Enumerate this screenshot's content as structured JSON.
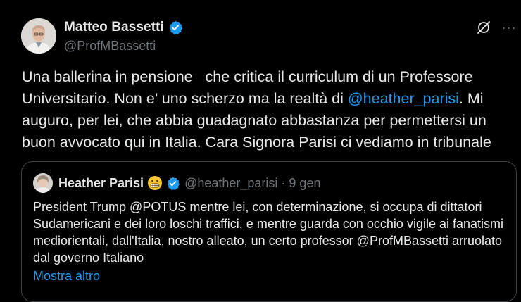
{
  "post": {
    "author": {
      "name": "Matteo Bassetti",
      "handle": "@ProfMBassetti",
      "verified": true
    },
    "text_part1": "Una ballerina in pensione   che critica il curriculum di un Professore Universitario. Non e’ uno scherzo ma la realtà di ",
    "mention": "@heather_parisi",
    "text_part2": ". Mi auguro, per lei, che abbia guadagnato abbastanza per permettersi un buon avvocato qui in Italia. Cara Signora Parisi ci vediamo in tribunale",
    "more_icon_glyph": "···"
  },
  "quote": {
    "author": {
      "name": "Heather Parisi",
      "handle": "@heather_parisi",
      "verified": true
    },
    "separator": "·",
    "date": "9 gen",
    "text": "President Trump @POTUS mentre lei, con determinazione, si occupa di dittatori Sudamericani e dei loro loschi traffici, e mentre guarda con occhio vigile ai fanatismi mediorientali, dall'Italia, nostro alleato, un certo professor @ProfMBassetti arruolato dal governo Italiano",
    "show_more": "Mostra altro"
  },
  "colors": {
    "background": "#000000",
    "text": "#e7e9ea",
    "muted": "#71767b",
    "link": "#1d9bf0",
    "border": "#3d4145"
  },
  "icons": [
    "verified-badge-icon",
    "grok-icon",
    "more-icon",
    "grimacing-face-emoji"
  ]
}
